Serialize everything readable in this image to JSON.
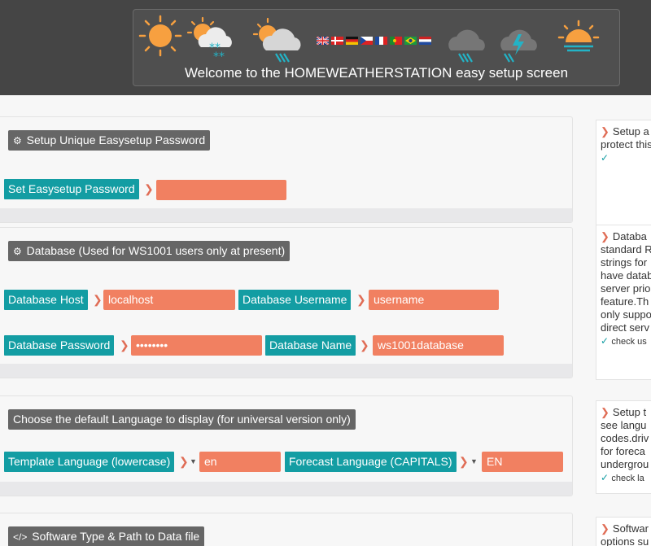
{
  "header": {
    "title": "Welcome to the HOMEWEATHERSTATION easy setup screen"
  },
  "sections": {
    "password": {
      "title": "Setup Unique Easysetup Password",
      "label": "Set Easysetup Password",
      "value": ""
    },
    "database": {
      "title": "Database (Used for WS1001 users only at present)",
      "host_label": "Database Host",
      "host_value": "localhost",
      "username_label": "Database Username",
      "username_value": "username",
      "password_label": "Database Password",
      "password_value": "••••••••",
      "name_label": "Database Name",
      "name_value": "ws1001database"
    },
    "language": {
      "title": "Choose the default Language to display (for universal version only)",
      "template_label": "Template Language (lowercase)",
      "template_value": "en",
      "forecast_label": "Forecast Language (CAPITALS)",
      "forecast_value": "EN"
    },
    "software": {
      "title": "Software Type & Path to Data file"
    }
  },
  "help": {
    "password": [
      "Setup a",
      "protect this"
    ],
    "password_check": "✓",
    "database": [
      "Databa",
      "standard R",
      "strings for",
      "have datab",
      "server prio",
      "feature.Th",
      "only suppo",
      "direct serv"
    ],
    "database_check": "check us",
    "language": [
      "Setup t",
      "see langu",
      "codes.driv",
      "for foreca",
      "undergrou"
    ],
    "language_check": "check la",
    "software": [
      "Softwar",
      "options su"
    ]
  },
  "flags": [
    "uk",
    "dk",
    "de",
    "cz",
    "fr",
    "pt",
    "br",
    "nl"
  ],
  "icons": [
    "sun-icon",
    "snow-cloud-icon",
    "rain-cloud-icon",
    "flag-row",
    "storm-cloud-icon",
    "thunder-cloud-icon",
    "sunrise-icon"
  ],
  "colors": {
    "accent_teal": "#139da3",
    "input_salmon": "#f18061",
    "header_bg": "#454545",
    "sun_orange": "#f7a040"
  }
}
